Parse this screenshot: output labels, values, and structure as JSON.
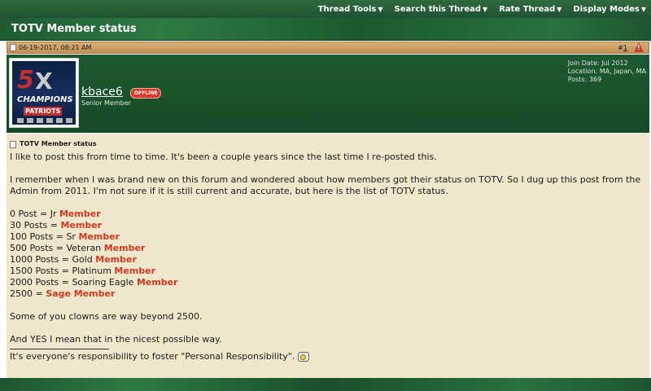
{
  "toolbar": {
    "items": [
      "Thread Tools",
      "Search this Thread",
      "Rate Thread",
      "Display Modes"
    ]
  },
  "thread": {
    "title": "TOTV Member status"
  },
  "post": {
    "date": "06-19-2017, 08:21 AM",
    "number_prefix": "#",
    "number": "1",
    "title": "TOTV Member status"
  },
  "user": {
    "name": "kbace6",
    "status_badge": "OFFLINE",
    "title": "Senior Member",
    "join_date": "Join Date: Jul 2012",
    "location": "Location: MA, Japan, MA",
    "posts": "Posts: 369",
    "avatar_text": {
      "five": "5",
      "x": "X",
      "champions": "CHAMPIONS",
      "team": "PATRIOTS"
    }
  },
  "body": {
    "p1": "I like to post this from time to time. It's been a couple years since the last time I re-posted this.",
    "p2": "I remember when I was brand new on this forum and wondered about how members got their status on TOTV. So I dug up this post from the Admin from 2011. I'm not sure if it is still current and accurate, but here is the list of TOTV status.",
    "statuses": [
      {
        "label": "0 Post = Jr ",
        "highlight": "Member"
      },
      {
        "label": "30 Posts = ",
        "highlight": "Member"
      },
      {
        "label": "100 Posts = Sr ",
        "highlight": "Member"
      },
      {
        "label": "500 Posts = Veteran ",
        "highlight": "Member"
      },
      {
        "label": "1000 Posts = Gold ",
        "highlight": "Member"
      },
      {
        "label": "1500 Posts = Platinum ",
        "highlight": "Member"
      },
      {
        "label": "2000 Posts = Soaring Eagle ",
        "highlight": "Member"
      },
      {
        "label": "2500 = ",
        "highlight": "Sage Member"
      }
    ],
    "p3": "Some of you clowns are way beyond 2500.",
    "p4": "And YES I mean that in the nicest possible way.",
    "signature": "It's everyone's responsibility to foster \"Personal Responsibility\"."
  },
  "colors": {
    "accent_red": "#d23a21",
    "header_green": "#1e5230",
    "post_bg": "#f0e6cb"
  }
}
